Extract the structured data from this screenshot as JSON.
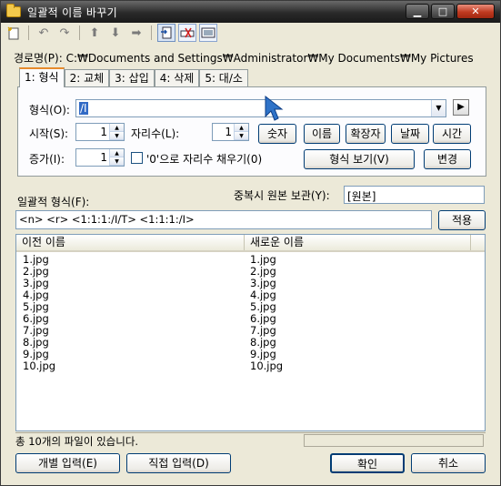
{
  "window": {
    "title": "일괄적 이름 바꾸기",
    "controls": [
      "minimize",
      "maximize",
      "close"
    ]
  },
  "toolbar": {
    "icons": [
      "new-document-icon",
      "undo-icon",
      "redo-icon",
      "move-up-icon",
      "move-down-icon",
      "move-right-icon",
      "rename-mode-icon",
      "delete-mode-icon",
      "preview-mode-icon"
    ]
  },
  "path": {
    "label": "경로명(P):",
    "value": "C:₩Documents and Settings₩Administrator₩My Documents₩My Pictures"
  },
  "tabs": [
    {
      "label": "1: 형식",
      "active": true
    },
    {
      "label": "2: 교체",
      "active": false
    },
    {
      "label": "3: 삽입",
      "active": false
    },
    {
      "label": "4: 삭제",
      "active": false
    },
    {
      "label": "5: 대/소",
      "active": false
    }
  ],
  "format_panel": {
    "format_label": "형식(O):",
    "format_value": "/I",
    "start_label": "시작(S):",
    "start_value": "1",
    "digits_label": "자리수(L):",
    "digits_value": "1",
    "increment_label": "증가(I):",
    "increment_value": "1",
    "zero_fill_label": "'0'으로 자리수 채우기(0)",
    "zero_fill_checked": false,
    "buttons": {
      "number": "숫자",
      "name": "이름",
      "extension": "확장자",
      "date": "날짜",
      "time": "시간",
      "show_format": "형식 보기(V)",
      "change": "변경"
    }
  },
  "duplicate": {
    "label": "중복시 원본 보관(Y):",
    "value": "[원본]"
  },
  "batch": {
    "label": "일괄적 형식(F):",
    "value": "<n> <r> <1:1:1:/I/T> <1:1:1:/I>",
    "apply_label": "적용"
  },
  "file_list": {
    "columns": [
      "이전 이름",
      "새로운 이름"
    ],
    "old_names": [
      "1.jpg",
      "2.jpg",
      "3.jpg",
      "4.jpg",
      "5.jpg",
      "6.jpg",
      "7.jpg",
      "8.jpg",
      "9.jpg",
      "10.jpg"
    ],
    "new_names": [
      "1.jpg",
      "2.jpg",
      "3.jpg",
      "4.jpg",
      "5.jpg",
      "6.jpg",
      "7.jpg",
      "8.jpg",
      "9.jpg",
      "10.jpg"
    ]
  },
  "status": {
    "text": "총 10개의 파일이 있습니다."
  },
  "footer": {
    "individual_input": "개별 입력(E)",
    "direct_input": "직접 입력(D)",
    "ok": "확인",
    "cancel": "취소"
  },
  "colors": {
    "titlebar": "#2a2a2a",
    "dialog_bg": "#ece9d8",
    "selection": "#316ac5",
    "button_border": "#003c74",
    "tab_highlight": "#e68b2c"
  }
}
